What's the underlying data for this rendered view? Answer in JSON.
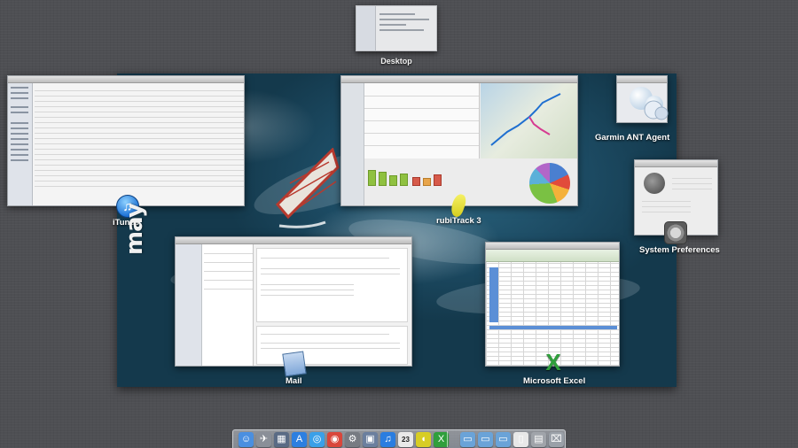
{
  "mission_control": {
    "desktop": {
      "label": "Desktop"
    },
    "apps": {
      "itunes": {
        "label": "iTunes"
      },
      "rubitrack": {
        "label": "rubiTrack 3"
      },
      "garmin": {
        "label": "Garmin ANT Agent"
      },
      "system_preferences": {
        "label": "System Preferences"
      },
      "mail": {
        "label": "Mail"
      },
      "excel": {
        "label": "Microsoft Excel"
      }
    },
    "wallpaper_text": "may"
  },
  "dock": {
    "items": [
      {
        "name": "finder-icon",
        "glyph": "☺",
        "color": "#4a8fe0"
      },
      {
        "name": "launchpad-icon",
        "glyph": "✈",
        "color": "#8a8f98"
      },
      {
        "name": "mission-control-icon",
        "glyph": "▦",
        "color": "#5a6b85"
      },
      {
        "name": "app-store-icon",
        "glyph": "A",
        "color": "#2d7fe0"
      },
      {
        "name": "safari-icon",
        "glyph": "◎",
        "color": "#3aa0e8"
      },
      {
        "name": "chrome-icon",
        "glyph": "◉",
        "color": "#d9463b"
      },
      {
        "name": "system-preferences-icon",
        "glyph": "⚙",
        "color": "#777b82"
      },
      {
        "name": "preview-icon",
        "glyph": "▣",
        "color": "#6b7f9e"
      },
      {
        "name": "itunes-icon",
        "glyph": "♫",
        "color": "#2a7de0"
      },
      {
        "name": "calendar-icon",
        "glyph": "23",
        "color": "#e9e9e9"
      },
      {
        "name": "rubitrack-icon",
        "glyph": "◖",
        "color": "#d7cd24"
      },
      {
        "name": "excel-icon",
        "glyph": "X",
        "color": "#2f9f3c"
      },
      {
        "name": "folder-icon",
        "glyph": "▭",
        "color": "#6aa3d8"
      },
      {
        "name": "documents-folder-icon",
        "glyph": "▭",
        "color": "#6aa3d8"
      },
      {
        "name": "downloads-folder-icon",
        "glyph": "▭",
        "color": "#6aa3d8"
      },
      {
        "name": "document-icon",
        "glyph": "▯",
        "color": "#e8e8e8"
      },
      {
        "name": "stack-icon",
        "glyph": "▤",
        "color": "#a0a4aa"
      },
      {
        "name": "trash-icon",
        "glyph": "⌧",
        "color": "#9aa0a8"
      }
    ]
  }
}
